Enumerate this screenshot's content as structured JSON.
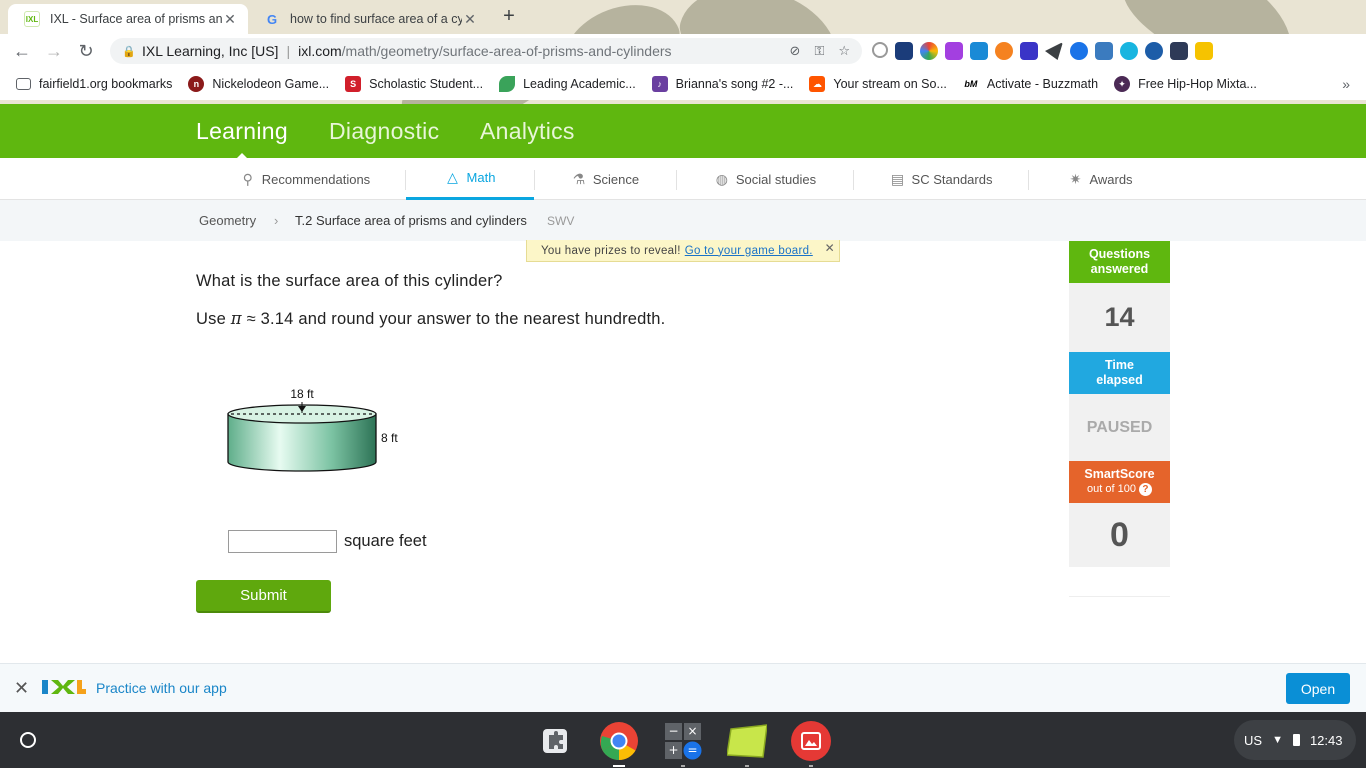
{
  "browser": {
    "tabs": [
      {
        "title": "IXL - Surface area of prisms and",
        "active": true,
        "favicon": "ixl-favicon"
      },
      {
        "title": "how to find surface area of a cyl",
        "active": false,
        "favicon": "google-favicon"
      }
    ],
    "address": {
      "org": "IXL Learning, Inc [US]",
      "host": "ixl.com",
      "path": "/math/geometry/surface-area-of-prisms-and-cylinders"
    },
    "bookmarks": [
      {
        "label": "fairfield1.org bookmarks",
        "icon": "folder-icon"
      },
      {
        "label": "Nickelodeon Game...",
        "icon": "nickelodeon-icon"
      },
      {
        "label": "Scholastic Student...",
        "icon": "scholastic-icon"
      },
      {
        "label": "Leading Academic...",
        "icon": "leaf-icon"
      },
      {
        "label": "Brianna's song #2 -...",
        "icon": "music-icon"
      },
      {
        "label": "Your stream on So...",
        "icon": "soundcloud-icon"
      },
      {
        "label": "Activate - Buzzmath",
        "icon": "buzzmath-icon"
      },
      {
        "label": "Free Hip-Hop Mixta...",
        "icon": "hiphop-icon"
      }
    ]
  },
  "ixl": {
    "top_nav": [
      "Learning",
      "Diagnostic",
      "Analytics"
    ],
    "sub_nav": [
      "Recommendations",
      "Math",
      "Science",
      "Social studies",
      "SC Standards",
      "Awards"
    ],
    "breadcrumb": {
      "subject": "Geometry",
      "skill": "T.2 Surface area of prisms and cylinders",
      "code": "SWV"
    },
    "prize": {
      "text": "You have prizes to reveal!",
      "link": "Go to your game board."
    },
    "question": "What is the surface area of this cylinder?",
    "instruction": {
      "use": "Use",
      "pi": "π",
      "rest": "≈ 3.14 and round your answer to the nearest hundredth."
    },
    "diagram": {
      "diameter_label": "18 ft",
      "height_label": "8 ft"
    },
    "answer": {
      "value": "",
      "unit": "square feet"
    },
    "submit_label": "Submit",
    "stats": {
      "questions_label": "Questions answered",
      "questions_value": "14",
      "time_label": "Time elapsed",
      "time_value": "PAUSED",
      "smartscore_label": "SmartScore",
      "smartscore_sub": "out of 100",
      "smartscore_value": "0"
    },
    "banner": {
      "text": "Practice with our app",
      "open_label": "Open"
    }
  },
  "system": {
    "locale": "US",
    "time": "12:43"
  },
  "colors": {
    "ixl_green": "#5fb70f",
    "ixl_blue": "#21a8e0",
    "ixl_orange": "#e5642b"
  }
}
